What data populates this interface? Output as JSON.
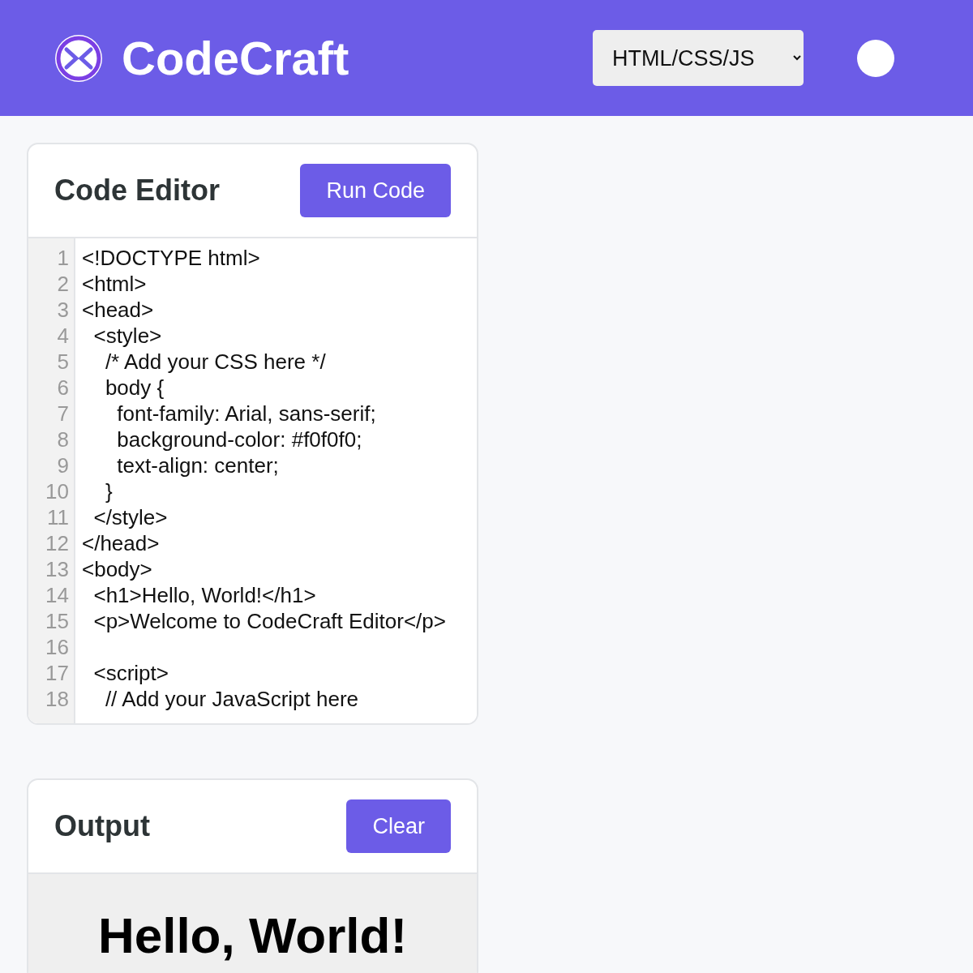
{
  "header": {
    "title": "CodeCraft",
    "language_select": {
      "value": "HTML/CSS/JS"
    }
  },
  "editor": {
    "title": "Code Editor",
    "run_button": "Run Code",
    "lines": [
      {
        "number": "1",
        "code": "<!DOCTYPE html>"
      },
      {
        "number": "2",
        "code": "<html>"
      },
      {
        "number": "3",
        "code": "<head>"
      },
      {
        "number": "4",
        "code": "  <style>"
      },
      {
        "number": "5",
        "code": "    /* Add your CSS here */"
      },
      {
        "number": "6",
        "code": "    body {"
      },
      {
        "number": "7",
        "code": "      font-family: Arial, sans-serif;"
      },
      {
        "number": "8",
        "code": "      background-color: #f0f0f0;"
      },
      {
        "number": "9",
        "code": "      text-align: center;"
      },
      {
        "number": "10",
        "code": "    }"
      },
      {
        "number": "11",
        "code": "  </style>"
      },
      {
        "number": "12",
        "code": "</head>"
      },
      {
        "number": "13",
        "code": "<body>"
      },
      {
        "number": "14",
        "code": "  <h1>Hello, World!</h1>"
      },
      {
        "number": "15",
        "code": "  <p>Welcome to CodeCraft Editor</p>"
      },
      {
        "number": "16"
      },
      {
        "number": "17",
        "code": "  <script>"
      },
      {
        "number": "18",
        "code": "    // Add your JavaScript here"
      }
    ]
  },
  "output": {
    "title": "Output",
    "clear_button": "Clear",
    "heading": "Hello, World!"
  }
}
